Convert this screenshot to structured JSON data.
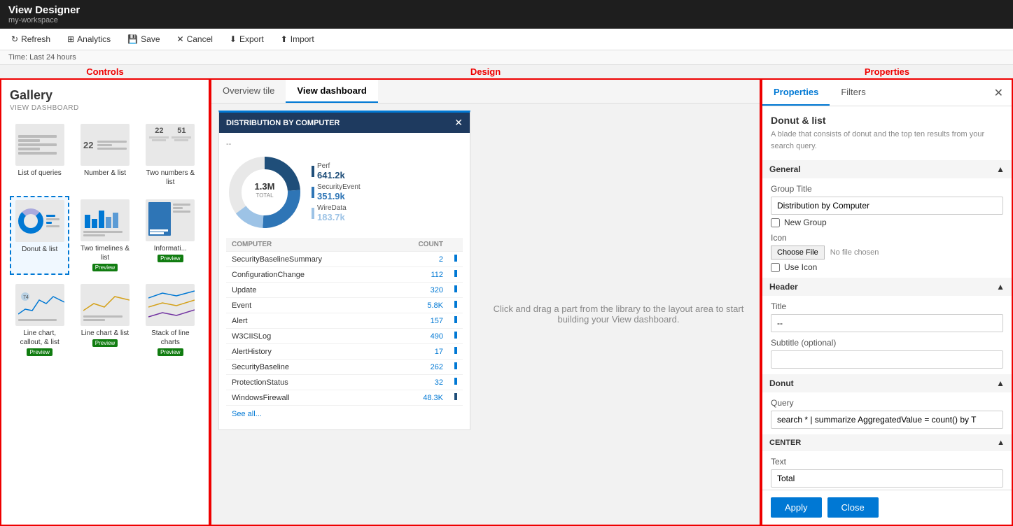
{
  "app": {
    "title": "View Designer",
    "workspace": "my-workspace"
  },
  "toolbar": {
    "refresh": "Refresh",
    "analytics": "Analytics",
    "save": "Save",
    "cancel": "Cancel",
    "export": "Export",
    "import": "Import"
  },
  "time_bar": {
    "label": "Time: Last 24 hours"
  },
  "section_labels": {
    "controls": "Controls",
    "design": "Design",
    "properties": "Properties"
  },
  "gallery": {
    "title": "Gallery",
    "subtitle": "VIEW DASHBOARD",
    "items": [
      {
        "id": "list-queries",
        "label": "List of queries",
        "type": "lines"
      },
      {
        "id": "number-list",
        "label": "Number & list",
        "numbers": "22",
        "type": "number"
      },
      {
        "id": "two-numbers",
        "label": "Two numbers & list",
        "numbers": "22  51",
        "type": "two-numbers"
      },
      {
        "id": "donut-list",
        "label": "Donut & list",
        "type": "donut",
        "selected": true
      },
      {
        "id": "two-timelines",
        "label": "Two timelines & list",
        "type": "timeline",
        "preview": true
      },
      {
        "id": "informati",
        "label": "Informati...",
        "type": "info",
        "preview": true
      },
      {
        "id": "line-callout",
        "label": "Line chart, callout, & list",
        "type": "line-chart",
        "preview": true
      },
      {
        "id": "line-list",
        "label": "Line chart & list",
        "type": "line-chart2",
        "preview": true
      },
      {
        "id": "stack-lines",
        "label": "Stack of line charts",
        "type": "stack",
        "preview": true
      }
    ]
  },
  "tabs": {
    "overview": "Overview tile",
    "dashboard": "View dashboard"
  },
  "tile": {
    "header": "DISTRIBUTION BY COMPUTER",
    "subtitle": "--",
    "total": "1.3M",
    "total_label": "TOTAL",
    "legend": [
      {
        "name": "Perf",
        "value": "641.2k",
        "color": "#1f4e79"
      },
      {
        "name": "SecurityEvent",
        "value": "351.9k",
        "color": "#2e75b6"
      },
      {
        "name": "WireData",
        "value": "183.7k",
        "color": "#9dc3e6"
      }
    ],
    "table_headers": [
      "COMPUTER",
      "COUNT"
    ],
    "rows": [
      {
        "computer": "SecurityBaselineSummary",
        "count": "2"
      },
      {
        "computer": "ConfigurationChange",
        "count": "112"
      },
      {
        "computer": "Update",
        "count": "320"
      },
      {
        "computer": "Event",
        "count": "5.8K"
      },
      {
        "computer": "Alert",
        "count": "157"
      },
      {
        "computer": "W3CIISLog",
        "count": "490"
      },
      {
        "computer": "AlertHistory",
        "count": "17"
      },
      {
        "computer": "SecurityBaseline",
        "count": "262"
      },
      {
        "computer": "ProtectionStatus",
        "count": "32"
      },
      {
        "computer": "WindowsFirewall",
        "count": "48.3K"
      }
    ],
    "see_all": "See all..."
  },
  "empty_canvas": {
    "message": "Click and drag a part from the library to the layout area to start building your View dashboard."
  },
  "properties": {
    "tabs": [
      "Properties",
      "Filters"
    ],
    "section": "Donut & list",
    "description": "A blade that consists of donut and the top ten results from your search query.",
    "general_label": "General",
    "group_title_label": "Group Title",
    "group_title_value": "Distribution by Computer",
    "new_group_label": "New Group",
    "icon_label": "Icon",
    "choose_file": "Choose File",
    "no_file": "No file chosen",
    "use_icon_label": "Use Icon",
    "header_label": "Header",
    "title_label": "Title",
    "title_value": "--",
    "subtitle_label": "Subtitle (optional)",
    "subtitle_value": "",
    "donut_label": "Donut",
    "query_label": "Query",
    "query_value": "search * | summarize AggregatedValue = count() by T",
    "center_label": "CENTER",
    "text_label": "Text",
    "text_value": "Total",
    "apply": "Apply",
    "close": "Close"
  }
}
